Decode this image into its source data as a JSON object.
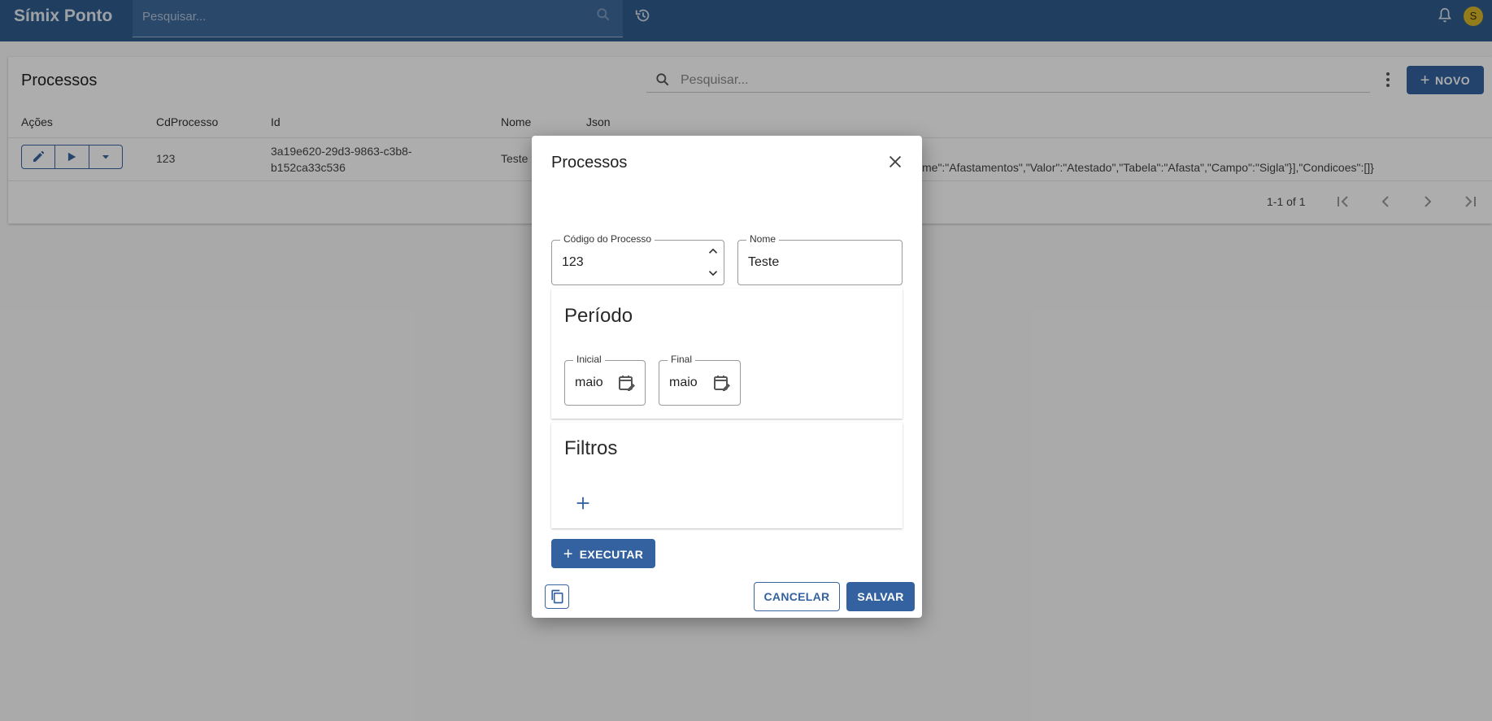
{
  "appbar": {
    "brand": "Símix Ponto",
    "search_placeholder": "Pesquisar...",
    "avatar_initial": "S",
    "icons": [
      "search-icon",
      "history-icon",
      "bell-icon"
    ]
  },
  "card": {
    "title": "Processos",
    "search_placeholder": "Pesquisar...",
    "new_label": "NOVO",
    "columns": [
      "Ações",
      "CdProcesso",
      "Id",
      "Nome",
      "Json"
    ],
    "rows": [
      {
        "cd": "123",
        "id_line1": "3a19e620-29d3-9863-c3b8-",
        "id_line2": "b152ca33c536",
        "nome": "Teste",
        "json_visible": "me\":\"Afastamentos\",\"Valor\":\"Atestado\",\"Tabela\":\"Afasta\",\"Campo\":\"Sigla\"}],\"Condicoes\":[]}"
      }
    ],
    "pager": "1-1 of 1"
  },
  "dialog": {
    "title": "Processos",
    "codigo_label": "Código do Processo",
    "codigo_value": "123",
    "nome_label": "Nome",
    "nome_value": "Teste",
    "periodo_title": "Período",
    "inicial_label": "Inicial",
    "inicial_value": "maio",
    "final_label": "Final",
    "final_value": "maio",
    "filtros_title": "Filtros",
    "executar_label": "EXECUTAR",
    "cancel_label": "CANCELAR",
    "save_label": "SALVAR"
  },
  "colors": {
    "appbar": "#2f5c8e",
    "primary": "#3462a0",
    "avatar": "#d9b72a"
  }
}
